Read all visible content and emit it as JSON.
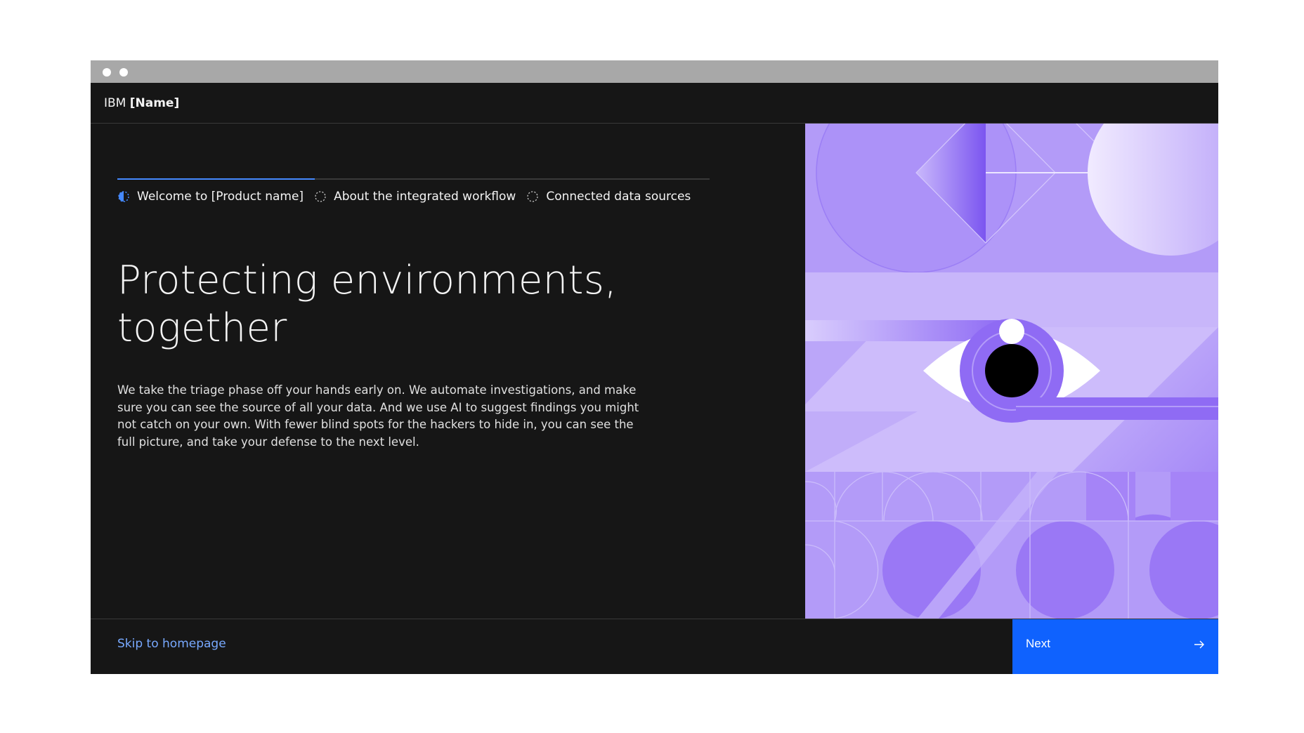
{
  "header": {
    "brand_prefix": "IBM",
    "brand_name": "[Name]"
  },
  "progress": {
    "current_step": 1,
    "steps": [
      {
        "label": "Welcome to [Product name]",
        "state": "current"
      },
      {
        "label": "About the integrated workflow",
        "state": "incomplete"
      },
      {
        "label": "Connected data sources",
        "state": "incomplete"
      }
    ]
  },
  "content": {
    "title_line1": "Protecting environments,",
    "title_line2": "together",
    "body": "We take the triage phase off your hands early on. We automate investigations, and make sure you can see the source of all your data. And we use AI to suggest findings you might not catch on your own. With fewer blind spots for the hackers to hide in, you can see the full picture, and take your defense to the next level."
  },
  "footer": {
    "skip_label": "Skip to homepage",
    "next_label": "Next"
  },
  "colors": {
    "accent": "#0f62fe",
    "progress_fill": "#4589ff",
    "link": "#78a9ff",
    "background": "#161616",
    "illustration_purple": "#a68bf7"
  },
  "icons": {
    "step_current": "half-filled-circle-icon",
    "step_incomplete": "dashed-circle-icon",
    "next": "arrow-right-icon"
  }
}
